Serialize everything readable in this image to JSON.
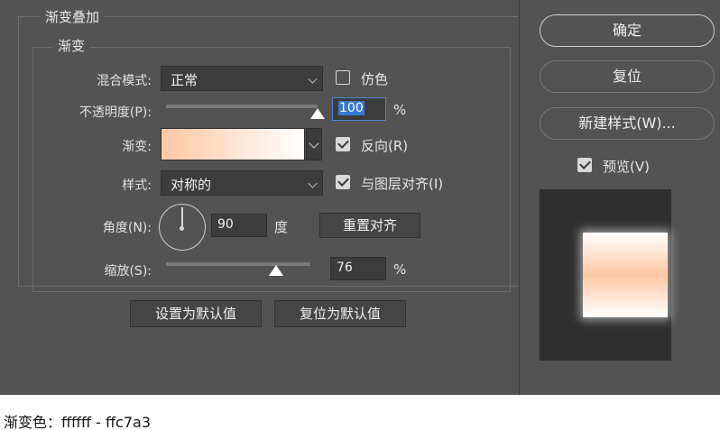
{
  "dialog": {
    "section_title": "渐变叠加",
    "subsection_title": "渐变",
    "blend_mode": {
      "label": "混合模式:",
      "value": "正常"
    },
    "dither": {
      "label": "仿色",
      "checked": false
    },
    "opacity": {
      "label": "不透明度(P):",
      "value": "100",
      "unit": "%",
      "level_percent": 100
    },
    "gradient": {
      "label": "渐变:",
      "colors": [
        "#ffc7a3",
        "#ffffff"
      ]
    },
    "reverse": {
      "label": "反向(R)",
      "checked": true
    },
    "style": {
      "label": "样式:",
      "value": "对称的"
    },
    "align_with_layer": {
      "label": "与图层对齐(I)",
      "checked": true
    },
    "angle": {
      "label": "角度(N):",
      "value": "90",
      "unit": "度",
      "reset_align_label": "重置对齐"
    },
    "scale": {
      "label": "缩放(S):",
      "value": "76",
      "unit": "%",
      "level_percent": 76
    },
    "make_default_label": "设置为默认值",
    "reset_default_label": "复位为默认值"
  },
  "side": {
    "ok_label": "确定",
    "reset_label": "复位",
    "new_style_label": "新建样式(W)...",
    "preview": {
      "label": "预览(V)",
      "checked": true
    }
  },
  "caption": "渐变色：ffffff - ffc7a3"
}
